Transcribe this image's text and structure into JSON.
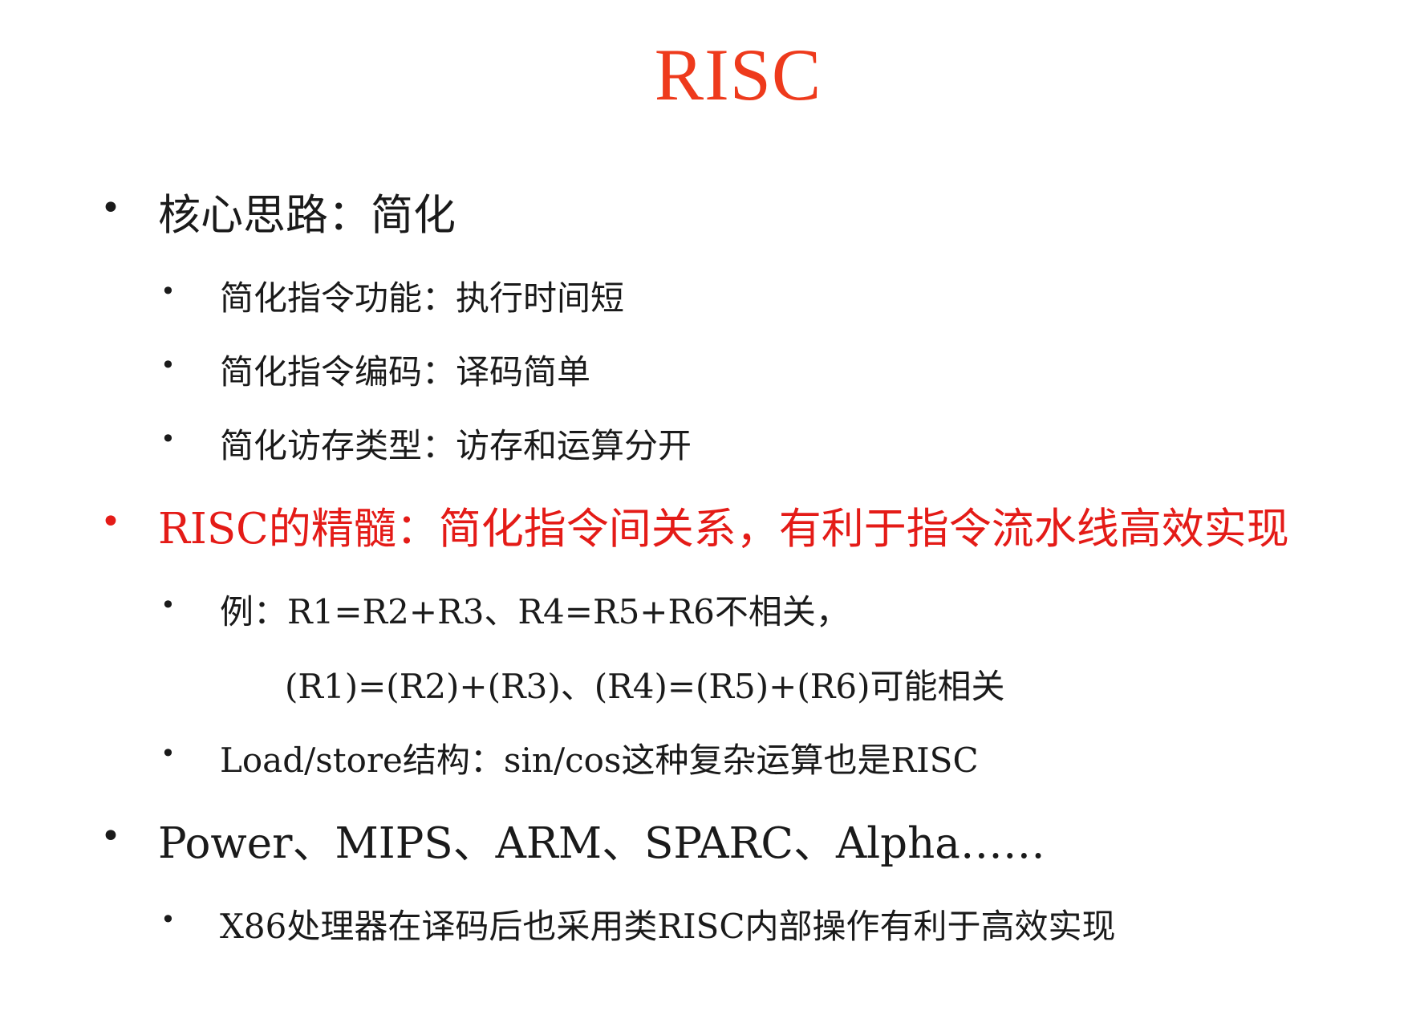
{
  "slide": {
    "title": "RISC",
    "bullets": [
      {
        "text": "核心思路：简化",
        "children": [
          "简化指令功能：执行时间短",
          "简化指令编码：译码简单",
          "简化访存类型：访存和运算分开"
        ]
      },
      {
        "text": "RISC的精髓：简化指令间关系，有利于指令流水线高效实现",
        "highlight_color": "#e41b17",
        "children": [
          "例：R1=R2+R3、R4=R5+R6不相关，",
          "(R1)=(R2)+(R3)、(R4)=(R5)+(R6)可能相关",
          "Load/store结构：sin/cos这种复杂运算也是RISC"
        ]
      },
      {
        "text": "Power、MIPS、ARM、SPARC、Alpha……",
        "children": [
          "X86处理器在译码后也采用类RISC内部操作有利于高效实现"
        ]
      }
    ],
    "bullet_symbol": "•",
    "title_color": "#ee3a1c"
  }
}
